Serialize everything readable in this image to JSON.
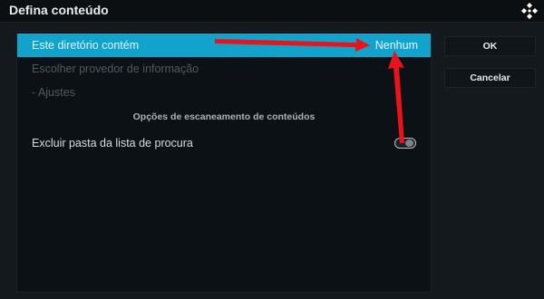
{
  "dialog": {
    "title": "Defina conteúdo"
  },
  "list": {
    "content_type_label": "Este diretório contém",
    "content_type_value": "Nenhum",
    "provider_label": "Escolher provedor de informação",
    "settings_label": "- Ajustes",
    "scan_section_title": "Opções de escaneamento de conteúdos",
    "exclude_label": "Excluir pasta da lista de procura",
    "exclude_enabled": false
  },
  "buttons": {
    "ok_label": "OK",
    "cancel_label": "Cancelar"
  },
  "colors": {
    "accent": "#12a3cd",
    "annotation_arrow": "#e8131b"
  },
  "icons": {
    "logo": "kodi-logo-icon"
  }
}
